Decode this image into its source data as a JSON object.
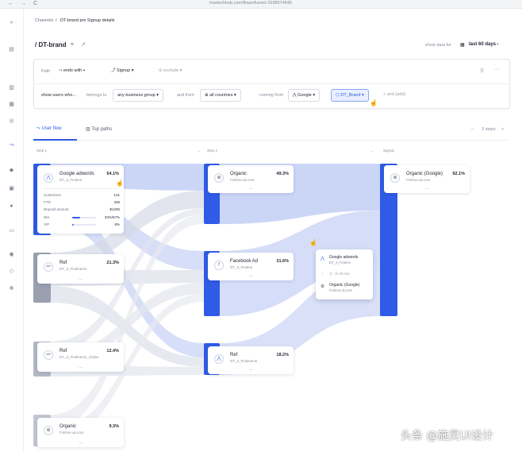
{
  "browser": {
    "url": "martechhub.com/flows/funnel-2938574545",
    "back": "←",
    "forward": "→",
    "reload": "C"
  },
  "breadcrumb": {
    "root": "Channels",
    "sep": "/",
    "current": "DT-brand pre Signup details"
  },
  "page": {
    "title": "/ DT-brand",
    "show_data_for": "show data for",
    "period": "last 60 days"
  },
  "path_row": {
    "path_label": "Path",
    "ends_with": "ends with",
    "signup": "Signup",
    "exclude": "exclude"
  },
  "filter_row": {
    "show_users": "show users who...",
    "belongs_to": "belongs to",
    "business_group": "any business group",
    "and_from": "and from",
    "countries": "all countries",
    "coming_from": "coming from",
    "google": "Google",
    "dt_brand": "DT_Brand",
    "and_add": "and (add)"
  },
  "tabs": [
    {
      "label": "User flow"
    },
    {
      "label": "Top paths"
    }
  ],
  "steps_ctrl": {
    "minus": "–",
    "value": "3 steps",
    "plus": "+"
  },
  "step_labels": [
    "Step 1",
    "Step 2",
    "Signup"
  ],
  "cards": {
    "google_adwords": {
      "name": "Google adwords",
      "sub": "DT_3_Fintime",
      "pct": "54.1%",
      "stats": [
        {
          "label": "Customers",
          "value": "141"
        },
        {
          "label": "FTD",
          "value": "336"
        },
        {
          "label": "Deposit amount",
          "value": "$1336"
        },
        {
          "label": "W/L",
          "value": "33%/67%"
        },
        {
          "label": "VIP",
          "value": "8%"
        }
      ],
      "wl_fill": 0.33,
      "vip_fill": 0.08
    },
    "ref1": {
      "name": "Ref",
      "sub": "DT_3_FintimeUK",
      "pct": "21.3%"
    },
    "ref2": {
      "name": "Ref",
      "sub": "DT_3_FintimeUK_Globe",
      "pct": "12.4%"
    },
    "organic1": {
      "name": "Organic",
      "sub": "Fintime.uk.com",
      "pct": "9.3%"
    },
    "organic_s2": {
      "name": "Organic",
      "sub": "Fintime.uk.com",
      "pct": "49.3%"
    },
    "facebook": {
      "name": "Facebook Ad",
      "sub": "DT_3_Fintime",
      "pct": "31.6%"
    },
    "ref_s2": {
      "name": "Ref",
      "sub": "DT_3_FintimeUK",
      "pct": "18.2%"
    },
    "organic_google": {
      "name": "Organic (Google)",
      "sub": "Fintime.uk.com",
      "pct": "92.1%"
    }
  },
  "tooltip": {
    "from_name": "Google adwords",
    "from_sub": "DT_3_Fintime",
    "time": "1h 35 min",
    "to_name": "Organic (Google)",
    "to_sub": "Fintime.uk.com"
  },
  "more": "...",
  "watermark": "头条 @施灵UI设计"
}
